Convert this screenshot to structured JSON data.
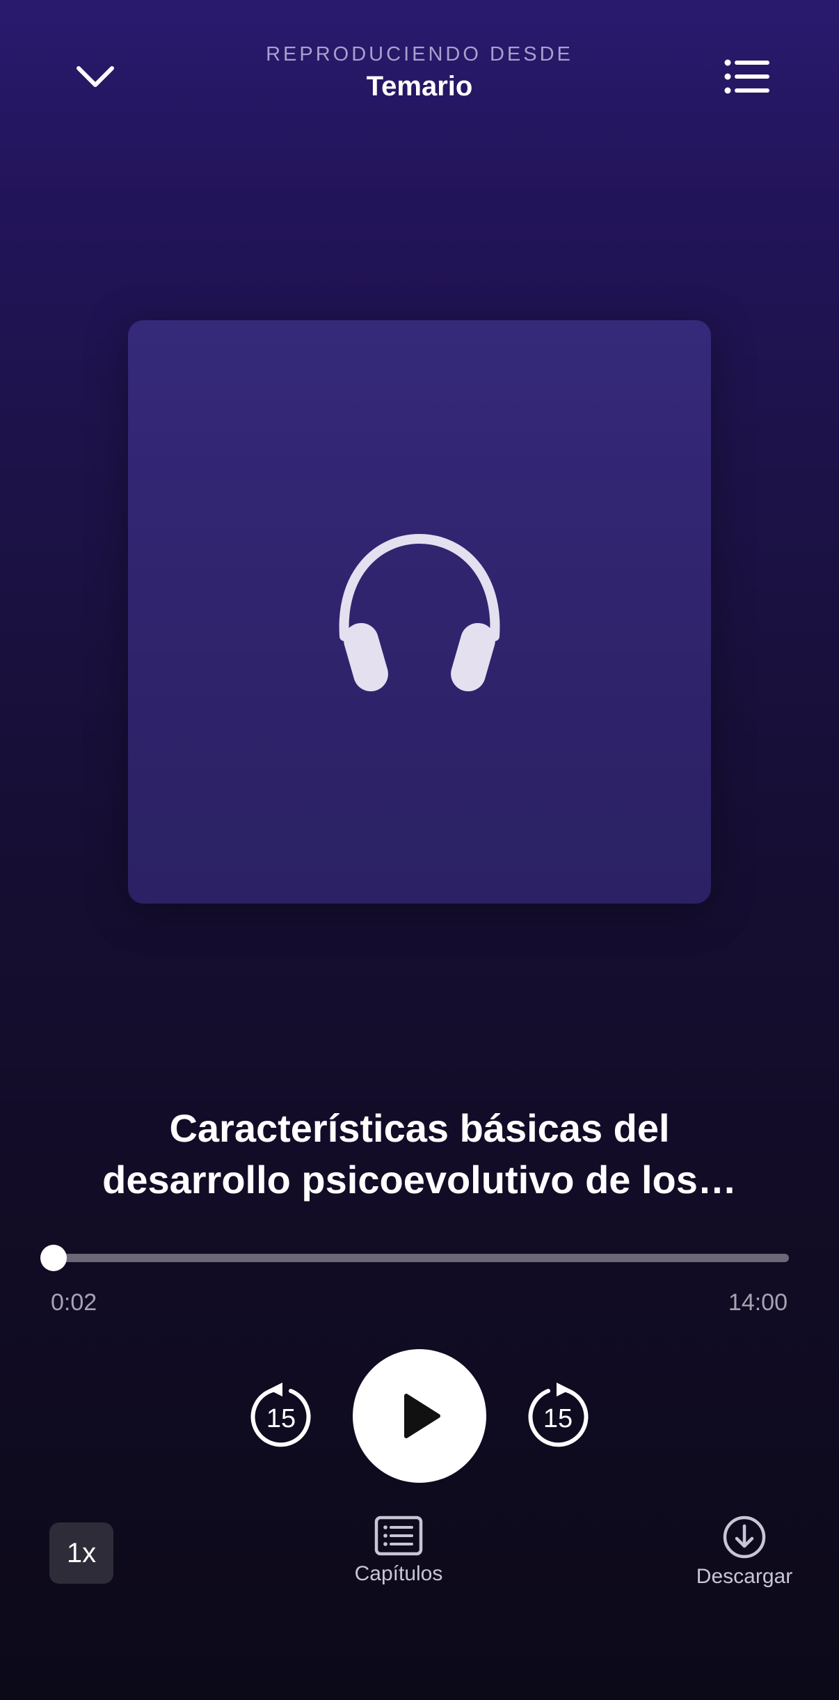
{
  "header": {
    "subtitle": "REPRODUCIENDO DESDE",
    "title": "Temario",
    "collapse_icon": "chevron-down-icon",
    "queue_icon": "list-icon"
  },
  "artwork": {
    "icon": "headphones-icon"
  },
  "track": {
    "title_line1": "Características básicas del",
    "title_line2": "desarrollo psicoevolutivo de los…"
  },
  "progress": {
    "elapsed": "0:02",
    "total": "14:00",
    "fraction": 0.0024
  },
  "controls": {
    "rewind_seconds": "15",
    "forward_seconds": "15",
    "play_icon": "play-icon"
  },
  "bottom_bar": {
    "speed_label": "1x",
    "chapters_label": "Capítulos",
    "download_label": "Descargar"
  },
  "colors": {
    "background_top": "#2a1a6e",
    "background_bottom": "#0c0a19",
    "artwork": "#30246e",
    "accent": "#ffffff"
  }
}
